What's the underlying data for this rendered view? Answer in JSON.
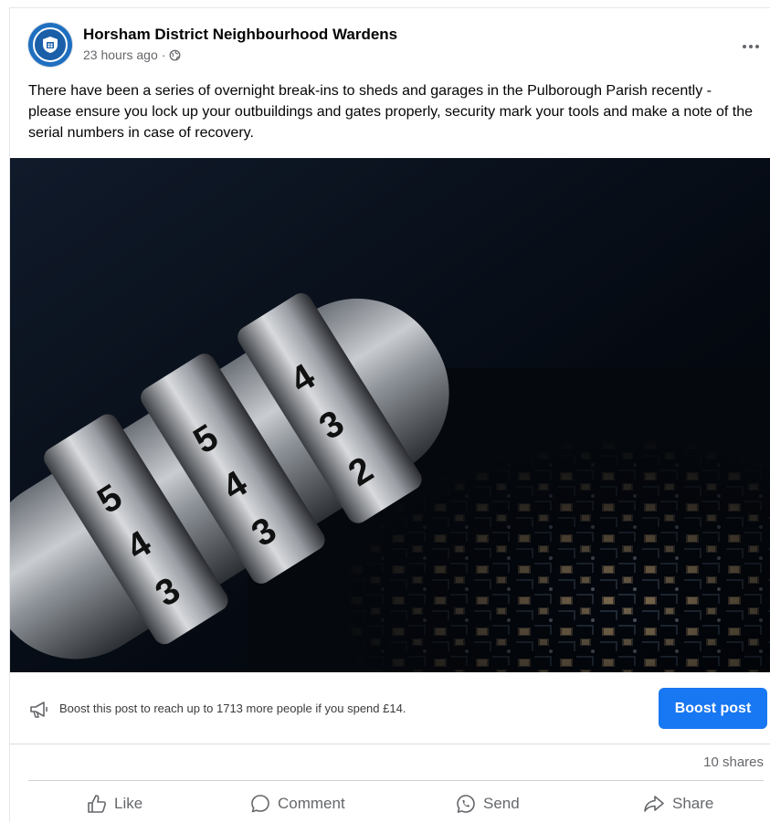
{
  "post": {
    "page_name": "Horsham District Neighbourhood Wardens",
    "timestamp": "23 hours ago",
    "separator": "·",
    "privacy_icon": "globe-icon",
    "more_icon": "more-options-icon",
    "text": "There have been a series of overnight break-ins to sheds and garages in the Pulborough Parish recently - please ensure you lock up your outbuildings and gates properly,  security mark your tools and make a note of the serial numbers in case of recovery.",
    "image_alt": "combination padlock on circuit board"
  },
  "boost": {
    "icon": "megaphone-icon",
    "text": "Boost this post to reach up to 1713 more people if you spend £14.",
    "button_label": "Boost post",
    "button_color": "#1877f2"
  },
  "stats": {
    "shares": "10 shares"
  },
  "actions": {
    "like": "Like",
    "comment": "Comment",
    "send": "Send",
    "share": "Share"
  }
}
